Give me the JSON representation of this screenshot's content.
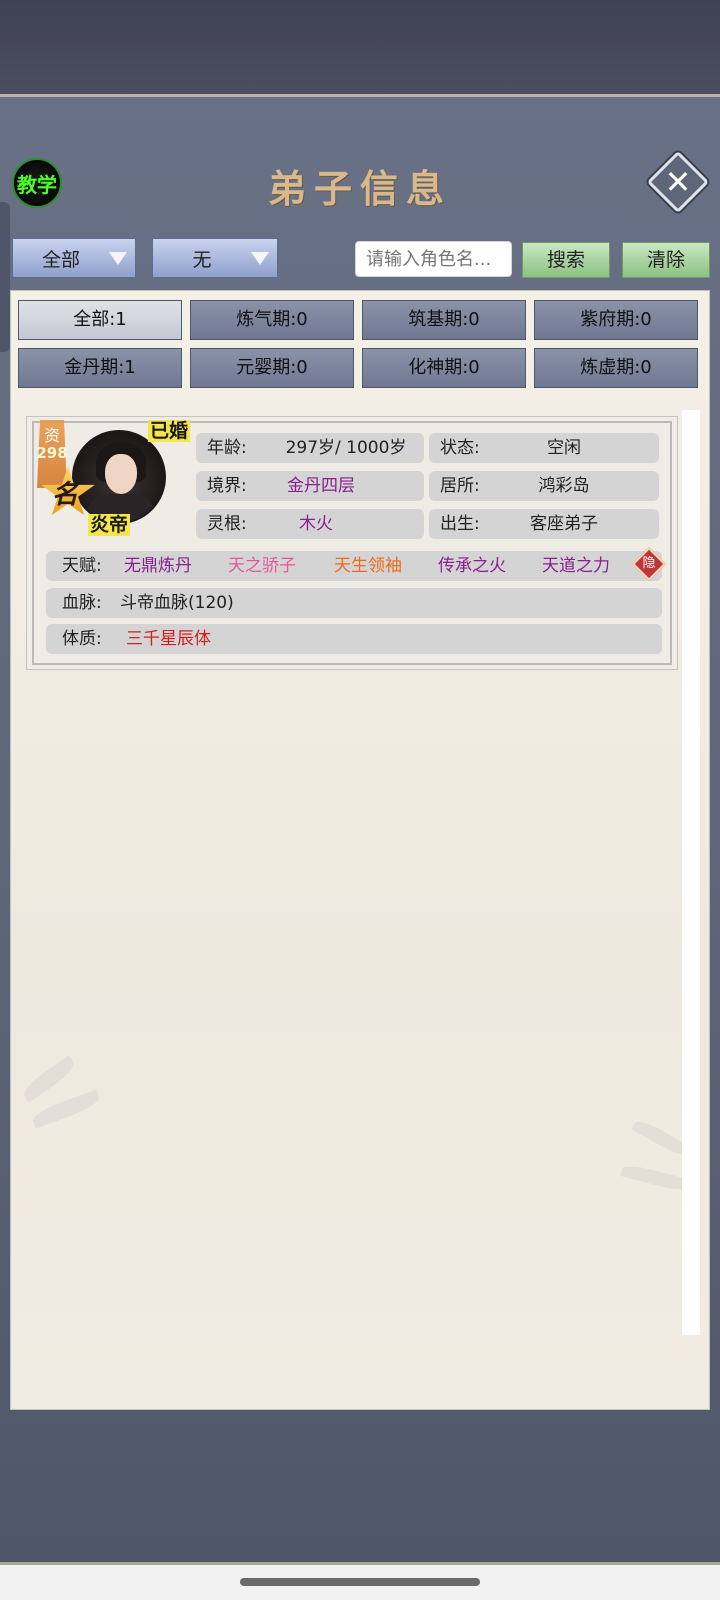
{
  "header": {
    "tutorial_label": "教学",
    "title": "弟子信息",
    "close_label": "✕"
  },
  "filters": {
    "dropdown1": "全部",
    "dropdown2": "无",
    "search_placeholder": "请输入角色名...",
    "search_button": "搜索",
    "clear_button": "清除"
  },
  "realm_tabs": [
    {
      "label": "全部:1",
      "active": true
    },
    {
      "label": "炼气期:0"
    },
    {
      "label": "筑基期:0"
    },
    {
      "label": "紫府期:0"
    },
    {
      "label": "金丹期:1"
    },
    {
      "label": "元婴期:0"
    },
    {
      "label": "化神期:0"
    },
    {
      "label": "炼虚期:0"
    }
  ],
  "disciple": {
    "aptitude_label": "资",
    "aptitude_value": "298",
    "fame_label": "名",
    "married_tag": "已婚",
    "name": "炎帝",
    "age_key": "年龄:",
    "age_value": "297岁/ 1000岁",
    "status_key": "状态:",
    "status_value": "空闲",
    "realm_key": "境界:",
    "realm_value": "金丹四层",
    "residence_key": "居所:",
    "residence_value": "鸿彩岛",
    "root_key": "灵根:",
    "root_value": "木火",
    "origin_key": "出生:",
    "origin_value": "客座弟子",
    "talent_key": "天赋:",
    "talents": [
      {
        "text": "无鼎炼丹",
        "color": "#8a1f8f"
      },
      {
        "text": "天之骄子",
        "color": "#e8559a"
      },
      {
        "text": "天生领袖",
        "color": "#ee6a1c"
      },
      {
        "text": "传承之火",
        "color": "#8a1f8f"
      },
      {
        "text": "天道之力",
        "color": "#8a1f8f"
      }
    ],
    "hide_label": "隐",
    "bloodline_key": "血脉:",
    "bloodline_value": "斗帝血脉(120)",
    "physique_key": "体质:",
    "physique_value": "三千星辰体",
    "physique_color": "#d41e1e"
  }
}
